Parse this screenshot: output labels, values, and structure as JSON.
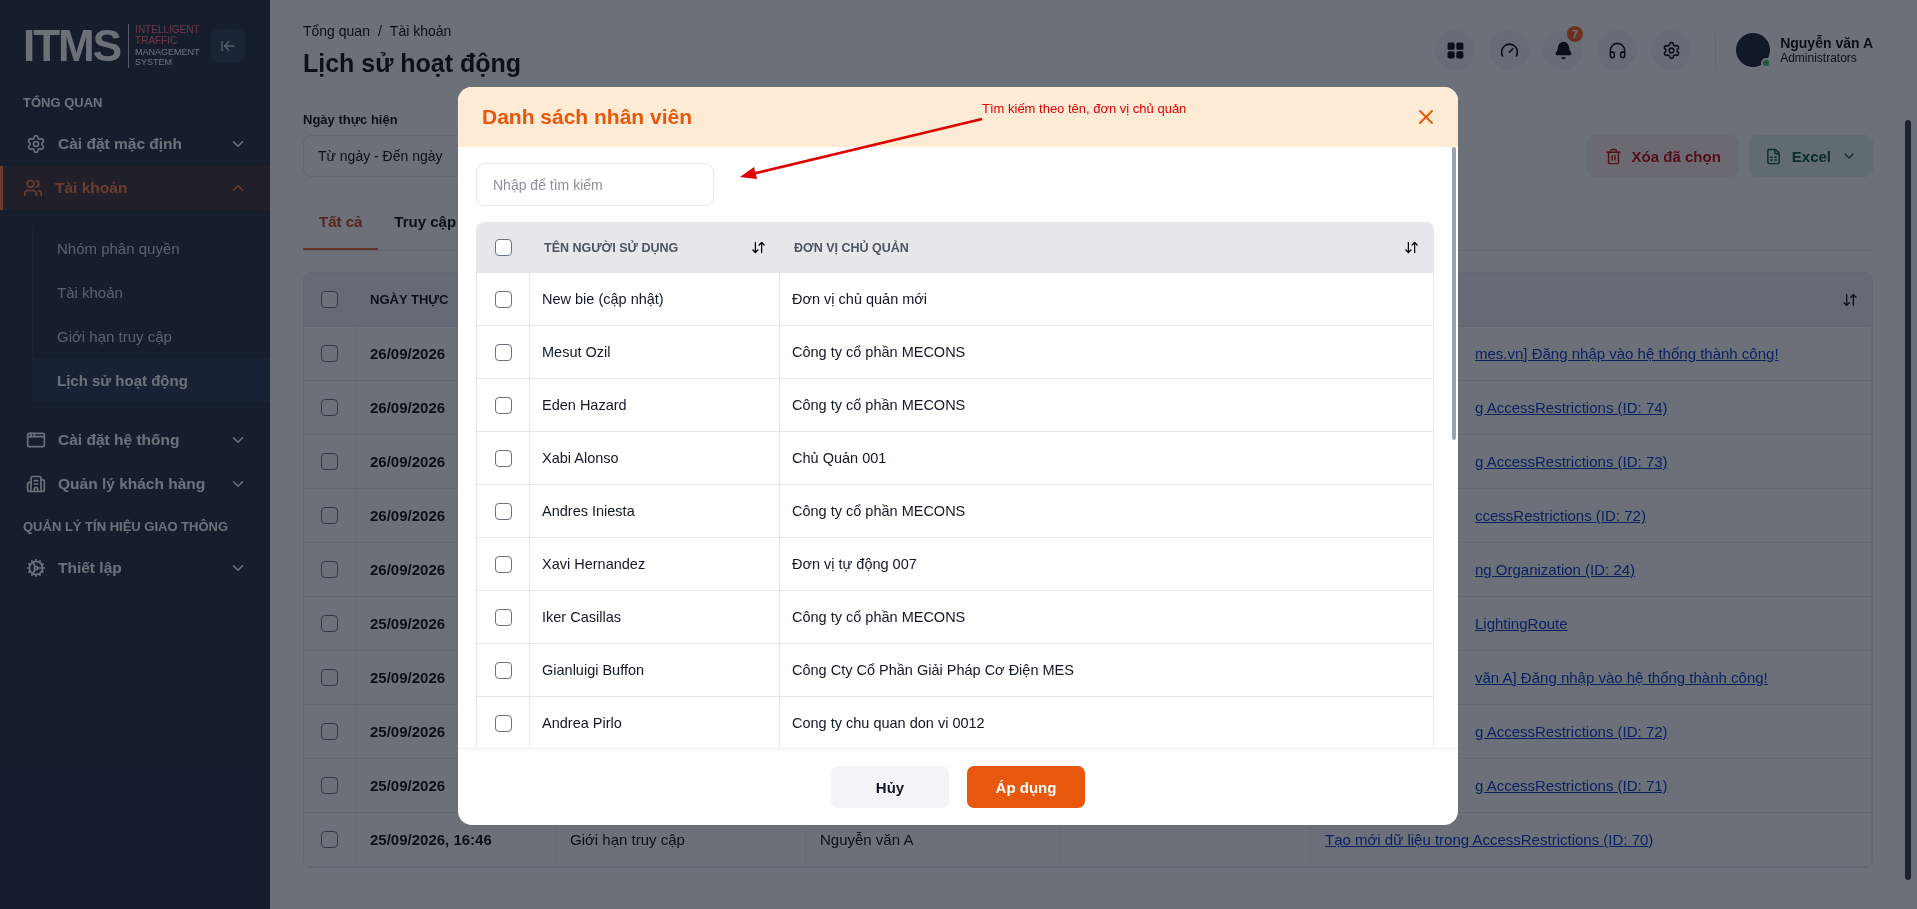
{
  "sidebar": {
    "logo": {
      "mark": "ITMS",
      "tagline_top": "INTELLIGENT TRAFFIC",
      "tagline_bottom": "MANAGEMENT SYSTEM"
    },
    "sections": [
      {
        "title": "TỔNG QUAN",
        "items": [
          {
            "label": "Cài đặt mặc định",
            "selected": false,
            "expanded": false
          },
          {
            "label": "Tài khoản",
            "selected": true,
            "expanded": true,
            "children": [
              {
                "label": "Nhóm phân quyền",
                "selected": false
              },
              {
                "label": "Tài khoản",
                "selected": false
              },
              {
                "label": "Giới hạn truy cập",
                "selected": false
              },
              {
                "label": "Lịch sử hoạt động",
                "selected": true
              }
            ]
          },
          {
            "label": "Cài đặt hệ thống",
            "selected": false,
            "expanded": false
          },
          {
            "label": "Quản lý khách hàng",
            "selected": false,
            "expanded": false
          }
        ]
      },
      {
        "title": "QUẢN LÝ TÍN HIỆU GIAO THÔNG",
        "items": [
          {
            "label": "Thiết lập",
            "selected": false,
            "expanded": false
          }
        ]
      }
    ]
  },
  "header": {
    "breadcrumb": [
      "Tổng quan",
      "Tài khoản"
    ],
    "breadcrumb_separator": "/",
    "title": "Lịch sử hoạt động",
    "notification_count": "7",
    "user": {
      "name": "Nguyễn văn A",
      "role": "Administrators"
    }
  },
  "filter": {
    "label": "Ngày thực hiện",
    "placeholder": "Từ ngày - Đến ngày",
    "delete_button": "Xóa đã chọn",
    "export_button": "Excel"
  },
  "tabs": [
    {
      "label": "Tất cả",
      "selected": true
    },
    {
      "label": "Truy cập",
      "selected": false
    }
  ],
  "table": {
    "columns": [
      "NGÀY THỰC"
    ],
    "select_all_checked": false,
    "rows": [
      {
        "kind": "covered",
        "checked": false,
        "date": "26/09/2026",
        "description": "mes.vn] Đăng nhập vào hệ thống thành công!"
      },
      {
        "kind": "covered",
        "checked": false,
        "date": "26/09/2026",
        "description": "g AccessRestrictions (ID: 74)"
      },
      {
        "kind": "covered",
        "checked": false,
        "date": "26/09/2026",
        "description": "g AccessRestrictions (ID: 73)"
      },
      {
        "kind": "covered",
        "checked": false,
        "date": "26/09/2026",
        "description": "ccessRestrictions (ID: 72)"
      },
      {
        "kind": "covered",
        "checked": false,
        "date": "26/09/2026",
        "description": "ng Organization (ID: 24)"
      },
      {
        "kind": "covered",
        "checked": false,
        "date": "25/09/2026",
        "description": "LightingRoute"
      },
      {
        "kind": "covered",
        "checked": false,
        "date": "25/09/2026",
        "description": "văn A] Đăng nhập vào hệ thống thành công!"
      },
      {
        "kind": "covered",
        "checked": false,
        "date": "25/09/2026",
        "description": "g AccessRestrictions (ID: 72)"
      },
      {
        "kind": "covered",
        "checked": false,
        "date": "25/09/2026",
        "description": "g AccessRestrictions (ID: 71)"
      },
      {
        "kind": "full",
        "checked": false,
        "date": "25/09/2026, 16:46",
        "type": "Giới hạn truy cập",
        "user": "Nguyễn văn A",
        "description": "Tạo mới dữ liệu trong AccessRestrictions (ID: 70)"
      }
    ]
  },
  "modal": {
    "title": "Danh sách nhân viên",
    "annotation": "Tìm kiếm theo tên, đơn vị chủ quản",
    "search_placeholder": "Nhập để tìm kiếm",
    "columns": [
      "TÊN NGƯỜI SỬ DỤNG",
      "ĐƠN VỊ CHỦ QUẢN"
    ],
    "select_all_checked": false,
    "rows": [
      {
        "checked": false,
        "name": "New bie (cập nhật)",
        "unit": "Đơn vị chủ quản mới"
      },
      {
        "checked": false,
        "name": "Mesut Ozil",
        "unit": "Công ty cổ phần MECONS"
      },
      {
        "checked": false,
        "name": "Eden Hazard",
        "unit": "Công ty cổ phần MECONS"
      },
      {
        "checked": false,
        "name": "Xabi Alonso",
        "unit": "Chủ Quản 001"
      },
      {
        "checked": false,
        "name": "Andres Iniesta",
        "unit": "Công ty cổ phần MECONS"
      },
      {
        "checked": false,
        "name": "Xavi Hernandez",
        "unit": "Đơn vị tự động 007"
      },
      {
        "checked": false,
        "name": "Iker Casillas",
        "unit": "Công ty cổ phần MECONS"
      },
      {
        "checked": false,
        "name": "Gianluigi Buffon",
        "unit": "Công Cty Cổ Phần Giải Pháp Cơ Điện MES"
      },
      {
        "checked": false,
        "name": "Andrea Pirlo",
        "unit": "Cong ty chu quan don vi 0012"
      }
    ],
    "cancel_button": "Hủy",
    "apply_button": "Áp dụng"
  }
}
